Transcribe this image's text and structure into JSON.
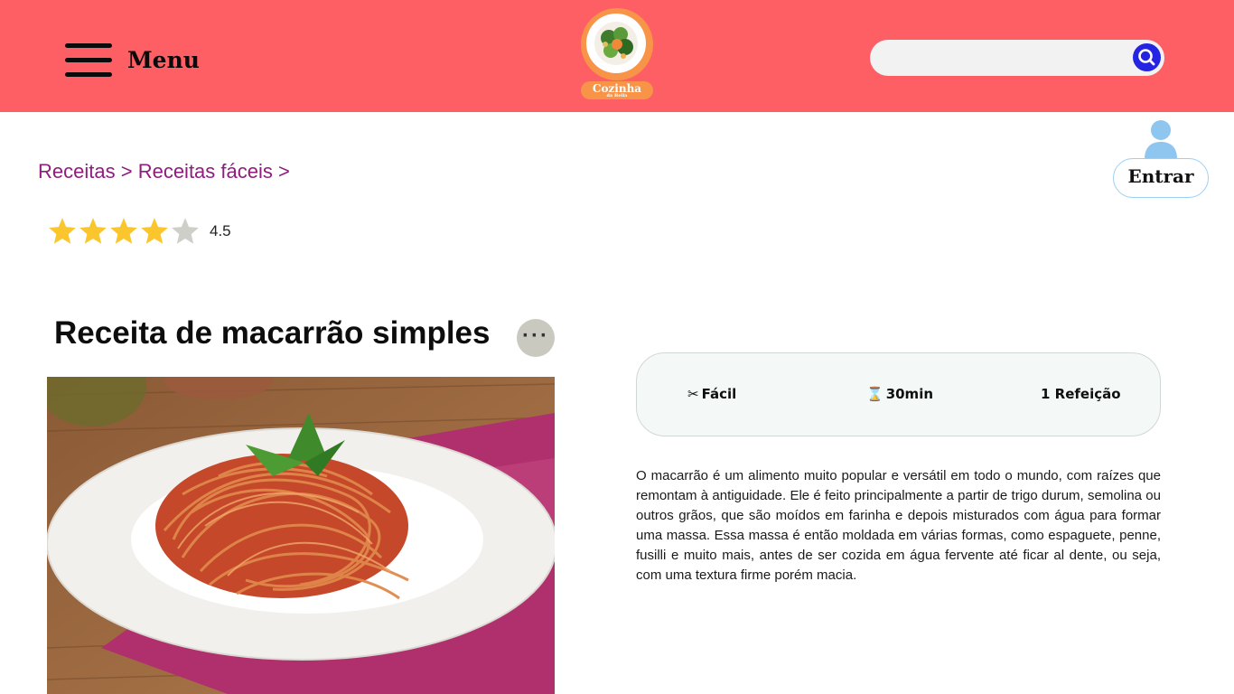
{
  "header": {
    "menu_label": "Menu",
    "logo_name": "Cozinha",
    "logo_subtitle": "da Bella",
    "search": {
      "placeholder": "",
      "value": ""
    },
    "colors": {
      "background": "#fd5f65",
      "search_button": "#2424e2",
      "logo_accent": "#f79448"
    }
  },
  "user": {
    "login_label": "Entrar",
    "icon": "user-icon"
  },
  "breadcrumb": {
    "items": [
      "Receitas",
      "Receitas fáceis"
    ],
    "separator": ">"
  },
  "rating": {
    "value": "4.5",
    "stars_total": 5,
    "stars_filled": 4,
    "star_color": "#fbc52d",
    "star_empty_color": "#cfcfc9"
  },
  "recipe": {
    "title": "Receita de macarrão simples",
    "more_label": "···",
    "difficulty": "Fácil",
    "time": "30min",
    "servings": "1 Refeição",
    "description": "O macarrão é um alimento muito popular e versátil em todo o mundo, com raízes que remontam à antiguidade. Ele é feito principalmente a partir de trigo durum, semolina ou outros grãos, que são moídos em farinha e depois misturados com água para formar uma massa. Essa massa é então moldada em várias formas, como espaguete, penne, fusilli e muito mais, antes de ser cozida em água fervente até ficar al dente, ou seja, com uma textura firme porém macia."
  }
}
